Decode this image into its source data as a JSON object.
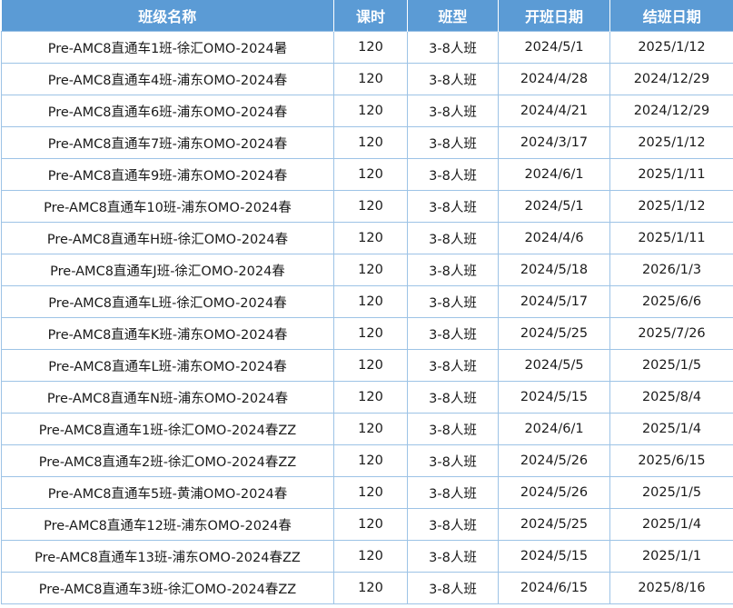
{
  "table": {
    "columns": [
      "班级名称",
      "课时",
      "班型",
      "开班日期",
      "结班日期"
    ],
    "rows": [
      [
        "Pre-AMC8直通车1班-徐汇OMO-2024暑",
        "120",
        "3-8人班",
        "2024/5/1",
        "2025/1/12"
      ],
      [
        "Pre-AMC8直通车4班-浦东OMO-2024春",
        "120",
        "3-8人班",
        "2024/4/28",
        "2024/12/29"
      ],
      [
        "Pre-AMC8直通车6班-浦东OMO-2024春",
        "120",
        "3-8人班",
        "2024/4/21",
        "2024/12/29"
      ],
      [
        "Pre-AMC8直通车7班-浦东OMO-2024春",
        "120",
        "3-8人班",
        "2024/3/17",
        "2025/1/12"
      ],
      [
        "Pre-AMC8直通车9班-浦东OMO-2024春",
        "120",
        "3-8人班",
        "2024/6/1",
        "2025/1/11"
      ],
      [
        "Pre-AMC8直通车10班-浦东OMO-2024春",
        "120",
        "3-8人班",
        "2024/5/1",
        "2025/1/12"
      ],
      [
        "Pre-AMC8直通车H班-徐汇OMO-2024春",
        "120",
        "3-8人班",
        "2024/4/6",
        "2025/1/11"
      ],
      [
        "Pre-AMC8直通车J班-徐汇OMO-2024春",
        "120",
        "3-8人班",
        "2024/5/18",
        "2026/1/3"
      ],
      [
        "Pre-AMC8直通车L班-徐汇OMO-2024春",
        "120",
        "3-8人班",
        "2024/5/17",
        "2025/6/6"
      ],
      [
        "Pre-AMC8直通车K班-浦东OMO-2024春",
        "120",
        "3-8人班",
        "2024/5/25",
        "2025/7/26"
      ],
      [
        "Pre-AMC8直通车L班-浦东OMO-2024春",
        "120",
        "3-8人班",
        "2024/5/5",
        "2025/1/5"
      ],
      [
        "Pre-AMC8直通车N班-浦东OMO-2024春",
        "120",
        "3-8人班",
        "2024/5/15",
        "2025/8/4"
      ],
      [
        "Pre-AMC8直通车1班-徐汇OMO-2024春ZZ",
        "120",
        "3-8人班",
        "2024/6/1",
        "2025/1/4"
      ],
      [
        "Pre-AMC8直通车2班-徐汇OMO-2024春ZZ",
        "120",
        "3-8人班",
        "2024/5/26",
        "2025/6/15"
      ],
      [
        "Pre-AMC8直通车5班-黄浦OMO-2024春",
        "120",
        "3-8人班",
        "2024/5/26",
        "2025/1/5"
      ],
      [
        "Pre-AMC8直通车12班-浦东OMO-2024春",
        "120",
        "3-8人班",
        "2024/5/25",
        "2025/1/4"
      ],
      [
        "Pre-AMC8直通车13班-浦东OMO-2024春ZZ",
        "120",
        "3-8人班",
        "2024/5/15",
        "2025/1/1"
      ],
      [
        "Pre-AMC8直通车3班-徐汇OMO-2024春ZZ",
        "120",
        "3-8人班",
        "2024/6/15",
        "2025/8/16"
      ]
    ]
  }
}
